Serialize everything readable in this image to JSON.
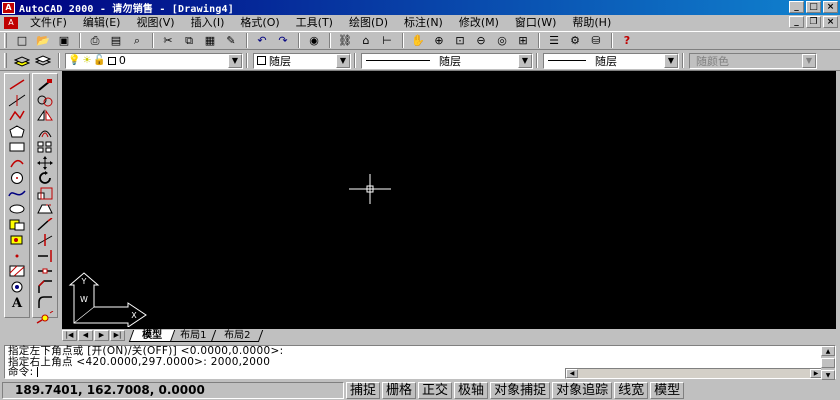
{
  "window": {
    "title": "AutoCAD 2000 - 请勿销售 - [Drawing4]",
    "controls": [
      "minimize",
      "maximize",
      "close"
    ]
  },
  "menu": [
    "文件(F)",
    "编辑(E)",
    "视图(V)",
    "插入(I)",
    "格式(O)",
    "工具(T)",
    "绘图(D)",
    "标注(N)",
    "修改(M)",
    "窗口(W)",
    "帮助(H)"
  ],
  "toolbar_standard": [
    {
      "name": "new-icon",
      "glyph": "□"
    },
    {
      "name": "open-icon",
      "glyph": "📂"
    },
    {
      "name": "save-icon",
      "glyph": "▣"
    },
    {
      "name": "print-icon",
      "glyph": "⎙"
    },
    {
      "name": "preview-icon",
      "glyph": "▤"
    },
    {
      "name": "find-icon",
      "glyph": "⌕"
    },
    {
      "name": "cut-icon",
      "glyph": "✂"
    },
    {
      "name": "copy-icon",
      "glyph": "⧉"
    },
    {
      "name": "paste-icon",
      "glyph": "▦"
    },
    {
      "name": "match-properties-icon",
      "glyph": "✎"
    },
    {
      "name": "undo-icon",
      "glyph": "↶"
    },
    {
      "name": "redo-icon",
      "glyph": "↷"
    },
    {
      "name": "web-icon",
      "glyph": "◉"
    },
    {
      "name": "insert-hyperlink-icon",
      "glyph": "⛓"
    },
    {
      "name": "object-snap-icon",
      "glyph": "⌂"
    },
    {
      "name": "ucs-icon",
      "glyph": "⊢"
    },
    {
      "name": "pan-icon",
      "glyph": "✋"
    },
    {
      "name": "zoom-realtime-icon",
      "glyph": "⊕"
    },
    {
      "name": "zoom-window-icon",
      "glyph": "⊡"
    },
    {
      "name": "zoom-previous-icon",
      "glyph": "⊖"
    },
    {
      "name": "aerial-view-icon",
      "glyph": "◎"
    },
    {
      "name": "named-views-icon",
      "glyph": "⊞"
    },
    {
      "name": "properties-icon",
      "glyph": "☰"
    },
    {
      "name": "design-center-icon",
      "glyph": "⚙"
    },
    {
      "name": "database-icon",
      "glyph": "⛁"
    },
    {
      "name": "help-icon",
      "glyph": "?"
    }
  ],
  "properties_toolbar": {
    "layer_value": "0",
    "color_value": "随层",
    "linetype_value": "随层",
    "lineweight_value": "随层",
    "plotstyle_value": "随颜色"
  },
  "draw_toolbar": [
    "line-icon",
    "construction-line-icon",
    "polyline-icon",
    "polygon-icon",
    "rectangle-icon",
    "arc-icon",
    "circle-icon",
    "spline-icon",
    "ellipse-icon",
    "insert-block-icon",
    "make-block-icon",
    "point-icon",
    "hatch-icon",
    "region-icon",
    "multiline-text-icon"
  ],
  "modify_toolbar": [
    "erase-icon",
    "copy-object-icon",
    "mirror-icon",
    "offset-icon",
    "array-icon",
    "move-icon",
    "rotate-icon",
    "scale-icon",
    "stretch-icon",
    "lengthen-icon",
    "trim-icon",
    "extend-icon",
    "break-icon",
    "chamfer-icon",
    "fillet-icon",
    "explode-icon"
  ],
  "ucs": {
    "x_label": "X",
    "y_label": "Y",
    "w_label": "W"
  },
  "tabs": [
    "模型",
    "布局1",
    "布局2"
  ],
  "active_tab": "模型",
  "command_lines": [
    "指定左下角点或 [开(ON)/关(OFF)] <0.0000,0.0000>:",
    "指定右上角点 <420.0000,297.0000>: 2000,2000"
  ],
  "command_prompt": "命令:",
  "coordinates": "189.7401, 162.7008, 0.0000",
  "status_toggles": [
    "捕捉",
    "栅格",
    "正交",
    "极轴",
    "对象捕捉",
    "对象追踪",
    "线宽",
    "模型"
  ],
  "colors": {
    "title_start": "#000080",
    "title_end": "#1084d0",
    "canvas": "#000000",
    "chrome": "#c0c0c0"
  }
}
